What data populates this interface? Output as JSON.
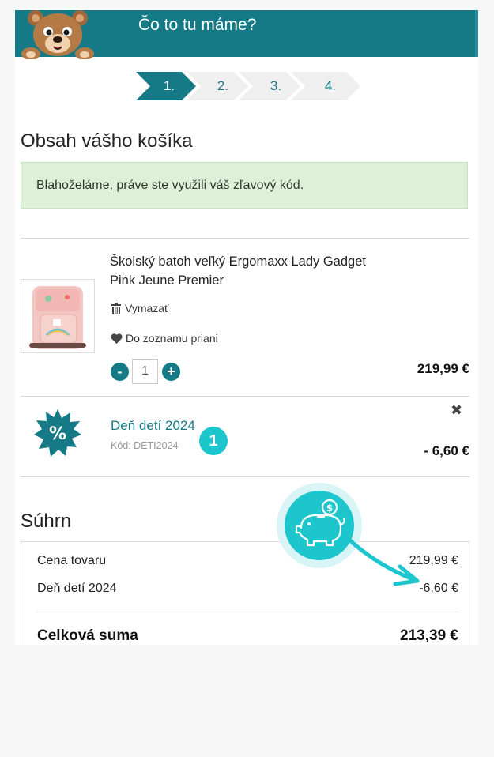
{
  "header": {
    "title": "Čo to tu máme?"
  },
  "steps": [
    "1.",
    "2.",
    "3.",
    "4."
  ],
  "cart": {
    "title": "Obsah vášho košíka",
    "alert": "Blahoželáme, práve ste využili váš zľavový kód."
  },
  "product": {
    "name": "Školský batoh veľký Ergomaxx Lady Gadget Pink Jeune Premier",
    "delete_label": "Vymazať",
    "wishlist_label": "Do zoznamu priani",
    "qty_minus": "-",
    "qty_plus": "+",
    "quantity": "1",
    "price": "219,99 €"
  },
  "discount": {
    "name": "Deň detí 2024",
    "code": "Kód: DETI2024",
    "amount": "- 6,60 €",
    "remove": "✖",
    "badge_symbol": "%",
    "step_badge": "1"
  },
  "summary": {
    "title": "Súhrn",
    "rows": [
      {
        "label": "Cena tovaru",
        "value": "219,99 €"
      },
      {
        "label": "Deň detí 2024",
        "value": "-6,60 €"
      }
    ],
    "total_label": "Celková suma",
    "total_value": "213,39 €"
  },
  "colors": {
    "brand": "#167a86",
    "accent": "#1cc6cc",
    "alert_bg": "#dff0d8"
  },
  "icons": [
    "bear-logo",
    "trash-icon",
    "heart-icon",
    "percent-badge-icon",
    "piggy-bank-icon",
    "close-icon"
  ]
}
